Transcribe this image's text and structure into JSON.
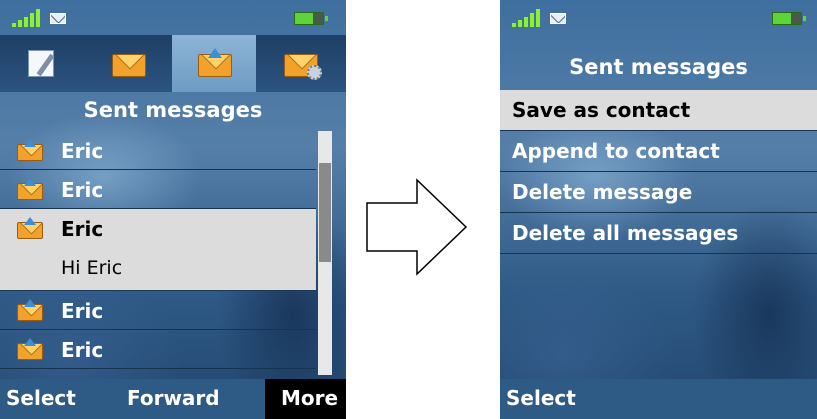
{
  "left_screen": {
    "title": "Sent messages",
    "tabs": [
      {
        "icon": "note-edit-icon"
      },
      {
        "icon": "envelope-icon"
      },
      {
        "icon": "sent-envelope-icon",
        "selected": true
      },
      {
        "icon": "settings-envelope-icon"
      }
    ],
    "messages": [
      {
        "name": "Eric"
      },
      {
        "name": "Eric"
      },
      {
        "name": "Eric",
        "preview": "Hi Eric",
        "selected": true
      },
      {
        "name": "Eric"
      },
      {
        "name": "Eric"
      }
    ],
    "softkeys": {
      "left": "Select",
      "middle": "Forward",
      "right": "More"
    }
  },
  "right_screen": {
    "title": "Sent messages",
    "menu": [
      {
        "label": "Save as contact",
        "selected": true
      },
      {
        "label": "Append to contact"
      },
      {
        "label": "Delete message"
      },
      {
        "label": "Delete all messages"
      }
    ],
    "softkeys": {
      "left": "Select"
    }
  },
  "colors": {
    "signal": "#8cf22c",
    "battery": "#5cd43a",
    "selection": "#dcdcdc",
    "softkey_bar": "#2d5b86"
  }
}
